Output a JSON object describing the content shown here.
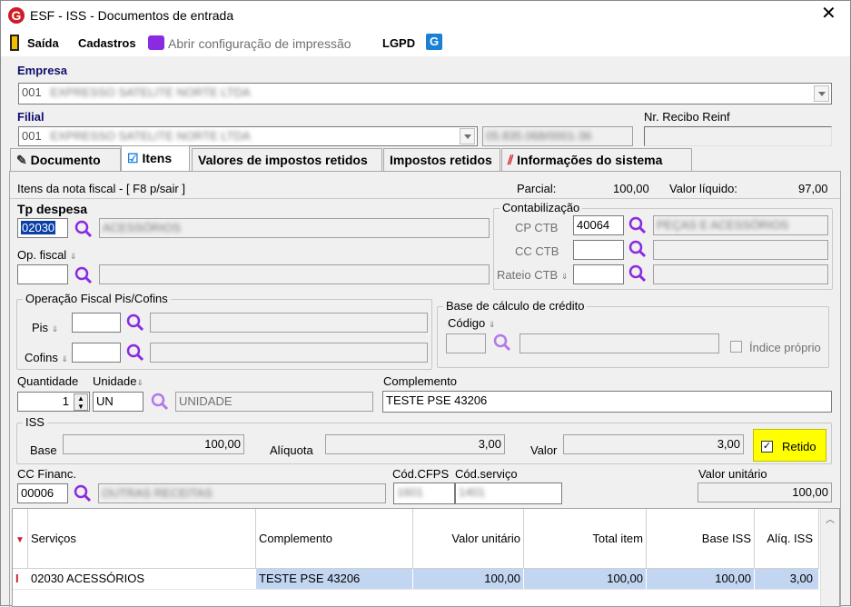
{
  "window": {
    "title": "ESF - ISS - Documentos de entrada"
  },
  "menu": {
    "exit": "Saída",
    "registrations": "Cadastros",
    "print_config": "Abrir configuração de impressão",
    "lgpd": "LGPD"
  },
  "empresa": {
    "label": "Empresa",
    "code": "001",
    "name": "EXPRESSO SATELITE NORTE LTDA"
  },
  "filial": {
    "label": "Filial",
    "code": "001",
    "name": "EXPRESSO SATELITE NORTE LTDA",
    "cnpj": "05.835.068/0001-36"
  },
  "recibo": {
    "label": "Nr. Recibo Reinf",
    "value": ""
  },
  "tabs": [
    "Documento",
    "Itens",
    "Valores de impostos retidos",
    "Impostos retidos",
    "Informações do sistema"
  ],
  "info_bar": {
    "text": "Itens da nota fiscal - [ F8 p/sair ]",
    "partial_label": "Parcial:",
    "partial_value": "100,00",
    "net_label": "Valor líquido:",
    "net_value": "97,00"
  },
  "expense": {
    "label": "Tp despesa",
    "code": "02030",
    "desc": "ACESSÓRIOS"
  },
  "fiscal_op": {
    "label": "Op. fiscal",
    "code": "",
    "desc": ""
  },
  "accounting": {
    "title": "Contabilização",
    "cp_label": "CP CTB",
    "cp_code": "40064",
    "cp_desc": "PEÇAS E ACESSÓRIOS",
    "cc_label": "CC CTB",
    "rateio_label": "Rateio CTB"
  },
  "piscofins": {
    "title": "Operação Fiscal Pis/Cofins",
    "pis_label": "Pis",
    "cofins_label": "Cofins"
  },
  "credit_base": {
    "title": "Base de cálculo de crédito",
    "code_label": "Código",
    "own_index_label": "Índice próprio"
  },
  "qty": {
    "label": "Quantidade",
    "value": "1"
  },
  "unit": {
    "label": "Unidade",
    "code": "UN",
    "desc": "UNIDADE"
  },
  "complement": {
    "label": "Complemento",
    "value": "TESTE PSE 43206"
  },
  "iss": {
    "title": "ISS",
    "base_label": "Base",
    "base_value": "100,00",
    "rate_label": "Alíquota",
    "rate_value": "3,00",
    "value_label": "Valor",
    "value_value": "3,00",
    "retained_label": "Retido",
    "retained": true
  },
  "cc_fin": {
    "label": "CC Financ.",
    "code": "00006",
    "desc": "OUTRAS RECEITAS"
  },
  "cfps": {
    "label": "Cód.CFPS",
    "value": "1601"
  },
  "service_code": {
    "label": "Cód.serviço",
    "value": "1401"
  },
  "unit_value": {
    "label": "Valor unitário",
    "value": "100,00"
  },
  "table": {
    "headers": [
      "Serviços",
      "Complemento",
      "Valor unitário",
      "Total item",
      "Base ISS",
      "Alíq. ISS"
    ],
    "rows": [
      [
        "02030 ACESSÓRIOS",
        "TESTE PSE 43206",
        "100,00",
        "100,00",
        "100,00",
        "3,00"
      ]
    ]
  },
  "colors": {
    "accent": "#10106e",
    "highlight": "#ffff00",
    "selected_row": "#c2d6f2",
    "icon": "#8a2be2"
  }
}
